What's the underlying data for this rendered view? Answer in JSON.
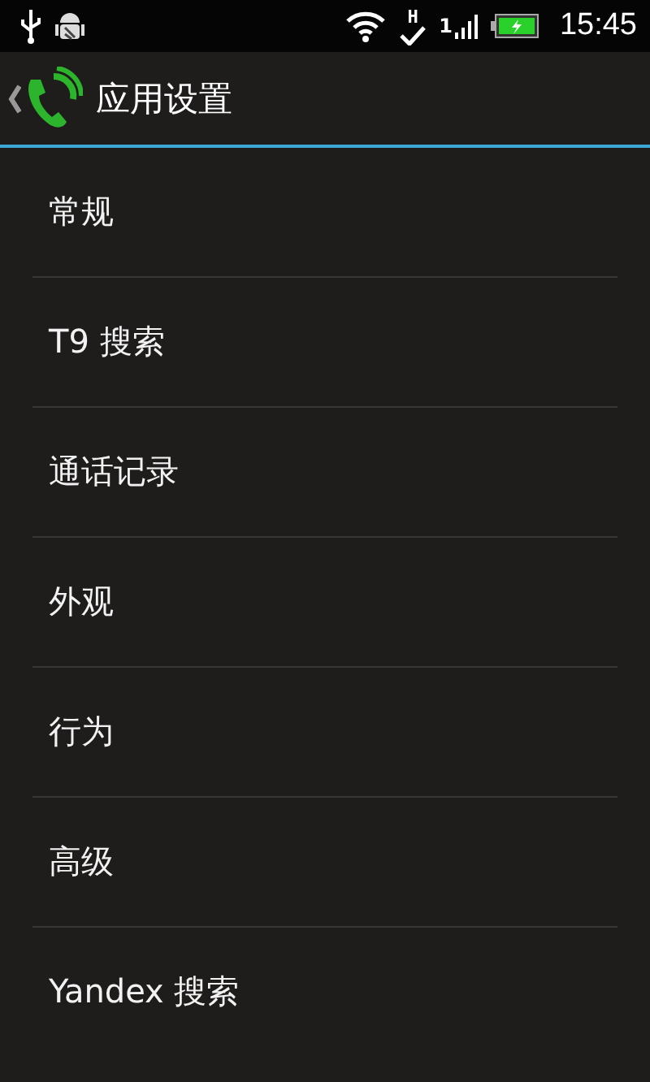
{
  "status_bar": {
    "network_type": "H",
    "sim_slot": "1",
    "time": "15:45"
  },
  "action_bar": {
    "title": "应用设置"
  },
  "items": [
    {
      "label": "常规"
    },
    {
      "label": "T9 搜索"
    },
    {
      "label": "通话记录"
    },
    {
      "label": "外观"
    },
    {
      "label": "行为"
    },
    {
      "label": "高级"
    },
    {
      "label": "Yandex 搜索"
    }
  ]
}
